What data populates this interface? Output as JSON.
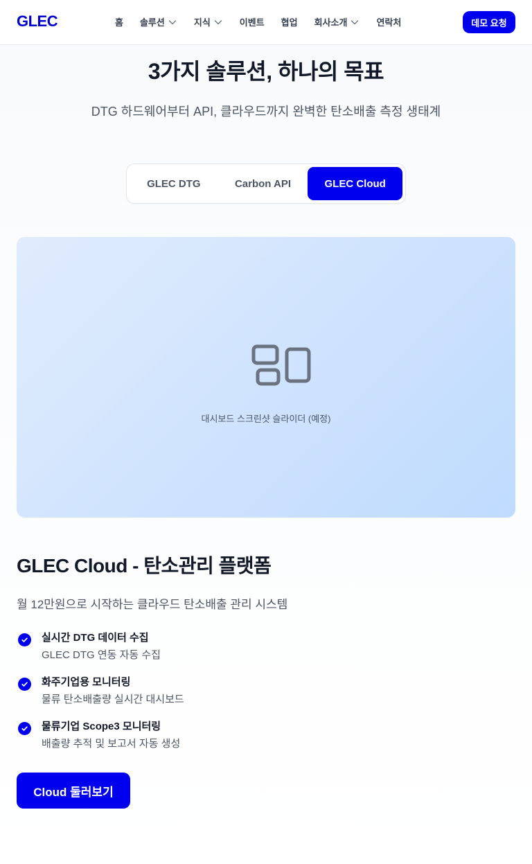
{
  "header": {
    "logo": "GLEC",
    "nav": [
      {
        "label": "홈",
        "has_dropdown": false
      },
      {
        "label": "솔루션",
        "has_dropdown": true
      },
      {
        "label": "지식",
        "has_dropdown": true
      },
      {
        "label": "이벤트",
        "has_dropdown": false
      },
      {
        "label": "협업",
        "has_dropdown": false
      },
      {
        "label": "회사소개",
        "has_dropdown": true
      },
      {
        "label": "연락처",
        "has_dropdown": false
      }
    ],
    "demo_button": "데모 요청"
  },
  "hero": {
    "title": "3가지 솔루션, 하나의 목표",
    "subtitle": "DTG 하드웨어부터 API, 클라우드까지 완벽한 탄소배출 측정 생태계"
  },
  "tabs": [
    {
      "label": "GLEC DTG",
      "active": false
    },
    {
      "label": "Carbon API",
      "active": false
    },
    {
      "label": "GLEC Cloud",
      "active": true
    }
  ],
  "preview": {
    "icon": "dashboard-icon",
    "caption": "대시보드 스크린샷 슬라이더 (예정)"
  },
  "product": {
    "title": "GLEC Cloud - 탄소관리 플랫폼",
    "description": "월 12만원으로 시작하는 클라우드 탄소배출 관리 시스템",
    "features": [
      {
        "title": "실시간 DTG 데이터 수집",
        "description": "GLEC DTG 연동 자동 수집"
      },
      {
        "title": "화주기업용 모니터링",
        "description": "물류 탄소배출량 실시간 대시보드"
      },
      {
        "title": "물류기업 Scope3 모니터링",
        "description": "배출량 추적 및 보고서 자동 생성"
      }
    ],
    "cta": "Cloud 둘러보기"
  },
  "colors": {
    "brand": "#0000ee",
    "logo": "#0000cc",
    "text_primary": "#111827",
    "text_secondary": "#4b5563",
    "preview_bg_start": "#e0ecfd",
    "preview_bg_end": "#bfdbfe"
  }
}
